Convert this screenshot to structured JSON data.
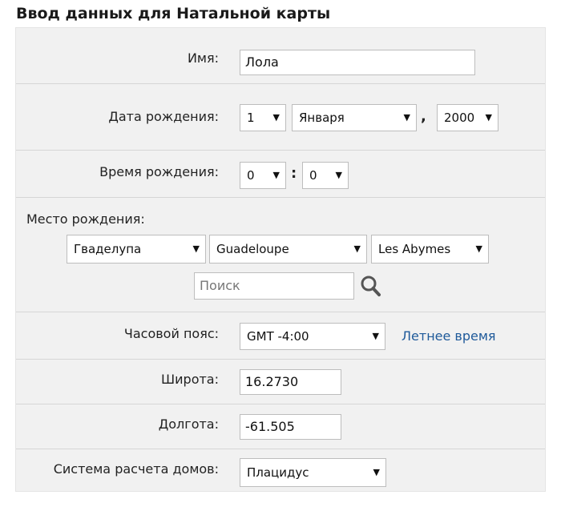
{
  "form_title": "Ввод данных для Натальной карты",
  "name": {
    "label": "Имя:",
    "value": "Лола"
  },
  "birth_date": {
    "label": "Дата рождения:",
    "day": "1",
    "month": "Января",
    "separator": ",",
    "year": "2000"
  },
  "birth_time": {
    "label": "Время рождения:",
    "hour": "0",
    "separator": ":",
    "minute": "0"
  },
  "birth_place": {
    "label": "Место рождения:",
    "country": "Гваделупа",
    "region": "Guadeloupe",
    "city": "Les Abymes",
    "search_placeholder": "Поиск",
    "search_icon": "magnifier-icon"
  },
  "timezone": {
    "label": "Часовой пояс:",
    "value": "GMT -4:00",
    "dst_link": "Летнее время"
  },
  "latitude": {
    "label": "Широта:",
    "value": "16.2730"
  },
  "longitude": {
    "label": "Долгота:",
    "value": "-61.505"
  },
  "house_system": {
    "label": "Система расчета домов:",
    "value": "Плацидус"
  },
  "dropdown_caret": "▼",
  "colors": {
    "panel_bg": "#f1f1f1",
    "link": "#1f5a9a",
    "border": "#bdbdbd"
  }
}
